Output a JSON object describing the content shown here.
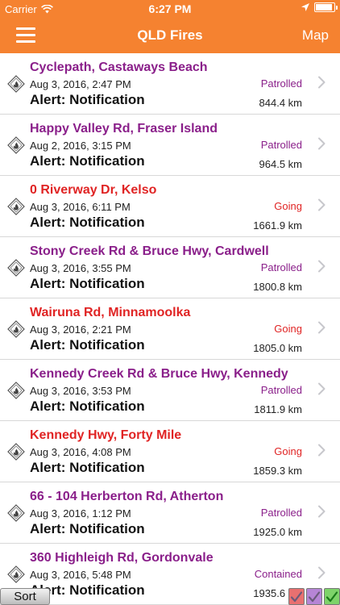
{
  "status_bar": {
    "carrier": "Carrier",
    "time": "6:27 PM",
    "battery_level": 0.9
  },
  "nav": {
    "title": "QLD Fires",
    "map_label": "Map",
    "menu_icon": "hamburger-menu-icon"
  },
  "colors": {
    "bar": "#f58230",
    "patrolled": "#8a1f8a",
    "going": "#e02424",
    "contained": "#8a1f8a"
  },
  "incidents": [
    {
      "name": "Cyclepath, Castaways Beach",
      "date": "Aug 3, 2016, 2:47 PM",
      "alert": "Alert: Notification",
      "status": "Patrolled",
      "distance": "844.4 km",
      "color": "#8a1f8a"
    },
    {
      "name": "Happy Valley Rd, Fraser Island",
      "date": "Aug 2, 2016, 3:15 PM",
      "alert": "Alert: Notification",
      "status": "Patrolled",
      "distance": "964.5 km",
      "color": "#8a1f8a"
    },
    {
      "name": "0 Riverway Dr, Kelso",
      "date": "Aug 3, 2016, 6:11 PM",
      "alert": "Alert: Notification",
      "status": "Going",
      "distance": "1661.9 km",
      "color": "#e02424"
    },
    {
      "name": "Stony Creek Rd & Bruce Hwy, Cardwell",
      "date": "Aug 3, 2016, 3:55 PM",
      "alert": "Alert: Notification",
      "status": "Patrolled",
      "distance": "1800.8 km",
      "color": "#8a1f8a"
    },
    {
      "name": "Wairuna Rd, Minnamoolka",
      "date": "Aug 3, 2016, 2:21 PM",
      "alert": "Alert: Notification",
      "status": "Going",
      "distance": "1805.0 km",
      "color": "#e02424"
    },
    {
      "name": "Kennedy Creek Rd & Bruce Hwy, Kennedy",
      "date": "Aug 3, 2016, 3:53 PM",
      "alert": "Alert: Notification",
      "status": "Patrolled",
      "distance": "1811.9 km",
      "color": "#8a1f8a"
    },
    {
      "name": "Kennedy Hwy, Forty Mile",
      "date": "Aug 3, 2016, 4:08 PM",
      "alert": "Alert: Notification",
      "status": "Going",
      "distance": "1859.3 km",
      "color": "#e02424"
    },
    {
      "name": "66 - 104 Herberton Rd, Atherton",
      "date": "Aug 3, 2016, 1:12 PM",
      "alert": "Alert: Notification",
      "status": "Patrolled",
      "distance": "1925.0 km",
      "color": "#8a1f8a"
    },
    {
      "name": "360 Highleigh Rd, Gordonvale",
      "date": "Aug 3, 2016, 5:48 PM",
      "alert": "Alert: Notification",
      "status": "Contained",
      "distance": "1935.6 km",
      "color": "#8a1f8a"
    }
  ],
  "toolbar": {
    "sort_label": "Sort",
    "filters": [
      {
        "name": "filter-red",
        "color": "#e87070"
      },
      {
        "name": "filter-purple",
        "color": "#b685d6"
      },
      {
        "name": "filter-green",
        "color": "#7ed36a"
      }
    ]
  }
}
